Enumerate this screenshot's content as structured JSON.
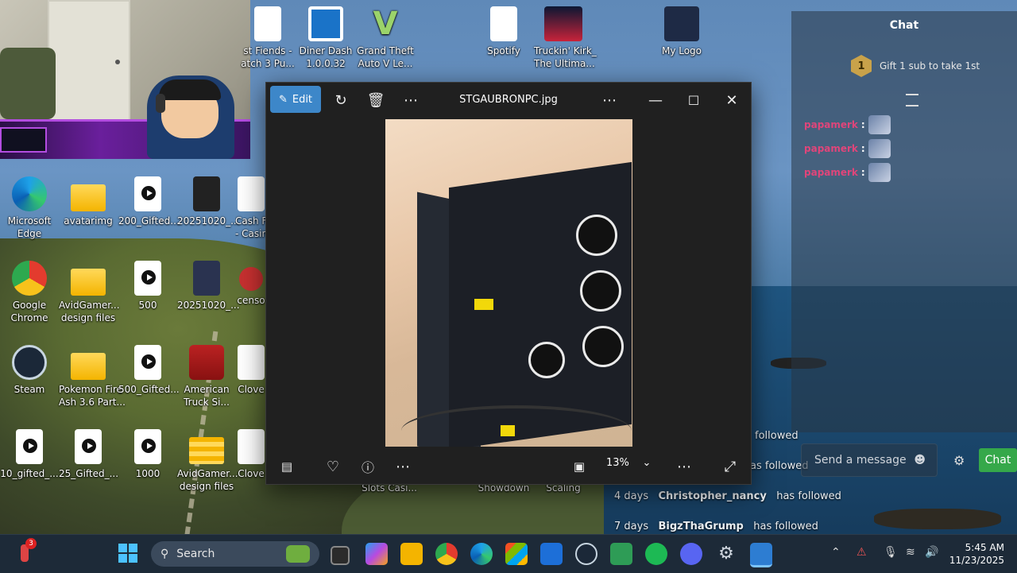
{
  "webcam": {
    "label": "streamer webcam overlay"
  },
  "desktop_icons": [
    {
      "label": "st Fiends -\natch 3 Pu..."
    },
    {
      "label": "Diner Dash\n1.0.0.32"
    },
    {
      "label": "Grand Theft\nAuto V Le..."
    },
    {
      "label": "Spotify"
    },
    {
      "label": "Truckin' Kirk_\nThe Ultima..."
    },
    {
      "label": "My Logo"
    },
    {
      "label": "Microsoft\nEdge"
    },
    {
      "label": "avatarimg"
    },
    {
      "label": "200_Gifted..."
    },
    {
      "label": "20251020_..."
    },
    {
      "label": "Cash F\n- Casin"
    },
    {
      "label": "Google\nChrome"
    },
    {
      "label": "AvidGamer...\ndesign files"
    },
    {
      "label": "500"
    },
    {
      "label": "20251020_..."
    },
    {
      "label": "censo"
    },
    {
      "label": "Steam"
    },
    {
      "label": "Pokemon Fire\nAsh 3.6 Part..."
    },
    {
      "label": "500_Gifted..."
    },
    {
      "label": "American\nTruck Si..."
    },
    {
      "label": "Clove"
    },
    {
      "label": "10_gifted_..."
    },
    {
      "label": "25_Gifted_..."
    },
    {
      "label": "1000"
    },
    {
      "label": "AvidGamer...\ndesign files"
    },
    {
      "label": "Clove"
    },
    {
      "label": "Slots Casi..."
    },
    {
      "label": "Showdown"
    },
    {
      "label": "Scaling"
    }
  ],
  "viewer": {
    "edit_label": "Edit",
    "title": "STGAUBRONPC.jpg",
    "zoom": "13%"
  },
  "chat": {
    "title": "Chat",
    "gift_badge": "1",
    "gift_text": "Gift 1 sub to take 1st",
    "messages": [
      {
        "user": "papamerk",
        "sep": ":"
      },
      {
        "user": "papamerk",
        "sep": ":"
      },
      {
        "user": "papamerk",
        "sep": ":"
      }
    ],
    "input_placeholder": "Send a message",
    "send_label": "Chat"
  },
  "follows": [
    {
      "time": "",
      "name": "",
      "action": "followed"
    },
    {
      "time": "",
      "name": "",
      "action": "as followed"
    },
    {
      "time": "4 days",
      "name": "Christopher_nancy",
      "action": "has followed"
    },
    {
      "time": "7 days",
      "name": "BigzThaGrump",
      "action": "has followed"
    }
  ],
  "taskbar": {
    "notification_count": "3",
    "search_placeholder": "Search",
    "time": "5:45 AM",
    "date": "11/23/2025"
  },
  "colors": {
    "accent": "#3d87c9",
    "chat_user": "#e0457a",
    "send": "#35a84a"
  }
}
